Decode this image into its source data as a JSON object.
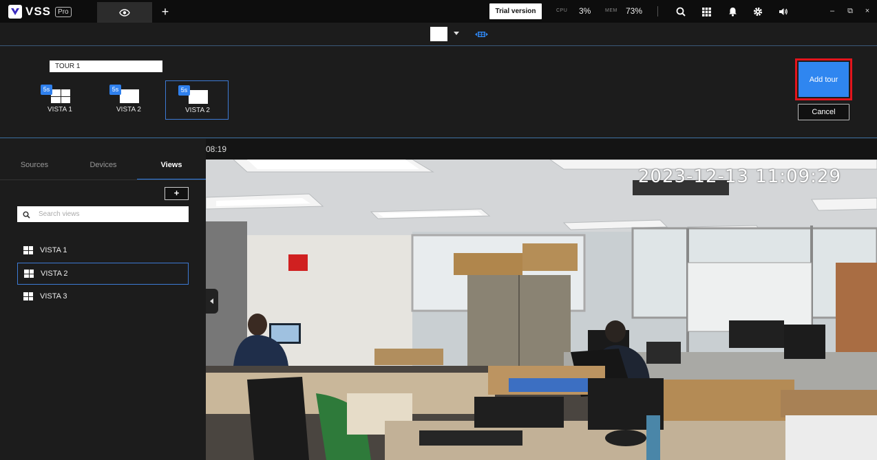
{
  "app": {
    "name": "VSS",
    "edition": "Pro"
  },
  "topbar": {
    "trial_label": "Trial version",
    "cpu_label": "CPU",
    "cpu_value": "3%",
    "mem_label": "MEM",
    "mem_value": "73%",
    "add_tab": "+",
    "win_minimize": "–",
    "win_restore": "⧉",
    "win_close": "×"
  },
  "tour": {
    "name_value": "TOUR 1",
    "items": [
      {
        "badge": "5s",
        "label": "VISTA 1",
        "layout": "grid4"
      },
      {
        "badge": "5s",
        "label": "VISTA 2",
        "layout": "single"
      },
      {
        "badge": "5s",
        "label": "VISTA 2",
        "layout": "single",
        "selected": true
      }
    ],
    "add_label": "Add tour",
    "cancel_label": "Cancel"
  },
  "left_panel": {
    "tabs": [
      "Sources",
      "Devices",
      "Views"
    ],
    "active_tab": "Views",
    "add_label": "+",
    "search_placeholder": "Search views",
    "views": [
      "VISTA 1",
      "VISTA 2",
      "VISTA 3"
    ],
    "selected_view": "VISTA 2"
  },
  "video": {
    "header_time": "08:19",
    "osd_timestamp": "2023-12-13 11:09:29"
  },
  "colors": {
    "accent": "#2f80ed",
    "highlight_border": "#e3141c",
    "background": "#1c1c1c"
  }
}
